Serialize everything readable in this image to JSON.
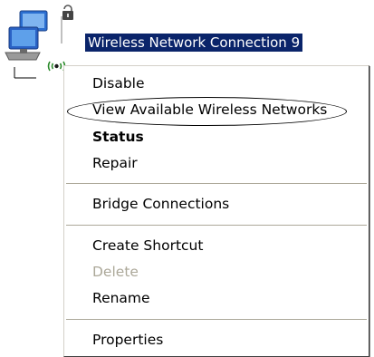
{
  "connection": {
    "label": "Wireless Network Connection 9",
    "label_bg": "#0a246a",
    "label_fg": "#ffffff"
  },
  "icon": {
    "name": "wireless-network-connection-icon"
  },
  "context_menu": {
    "items": [
      {
        "label": "Disable",
        "state": "normal"
      },
      {
        "label": "View Available Wireless Networks",
        "state": "normal",
        "circled": true
      },
      {
        "label": "Status",
        "state": "default-bold"
      },
      {
        "label": "Repair",
        "state": "normal"
      },
      {
        "label": "Bridge Connections",
        "state": "normal"
      },
      {
        "label": "Create Shortcut",
        "state": "normal"
      },
      {
        "label": "Delete",
        "state": "disabled"
      },
      {
        "label": "Rename",
        "state": "normal"
      },
      {
        "label": "Properties",
        "state": "normal"
      }
    ]
  }
}
